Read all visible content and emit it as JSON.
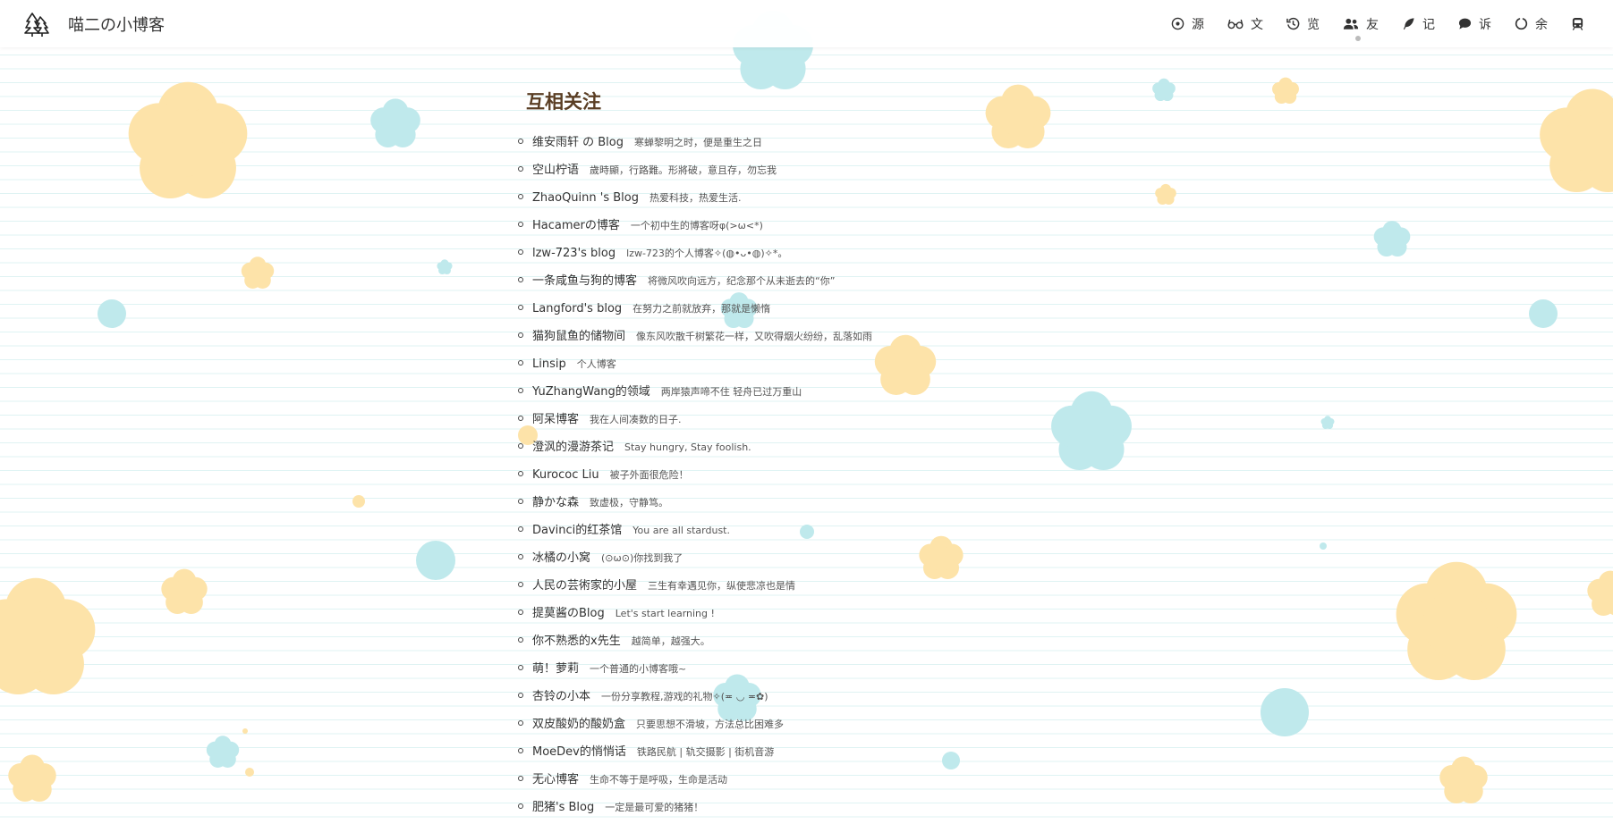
{
  "header": {
    "site_title": "喵二の小博客",
    "nav": [
      {
        "icon": "target-icon",
        "label": "源"
      },
      {
        "icon": "glasses-icon",
        "label": "文"
      },
      {
        "icon": "history-icon",
        "label": "览"
      },
      {
        "icon": "users-icon",
        "label": "友"
      },
      {
        "icon": "feather-icon",
        "label": "记"
      },
      {
        "icon": "comment-icon",
        "label": "诉"
      },
      {
        "icon": "circle-notch-icon",
        "label": "余"
      },
      {
        "icon": "train-icon",
        "label": ""
      }
    ]
  },
  "main": {
    "title": "互相关注",
    "friends": [
      {
        "name": "维安雨轩 の Blog",
        "desc": "寒蝉黎明之时，便是重生之日"
      },
      {
        "name": "空山柠语",
        "desc": "歲時顯，行路難。形將破，意且存，勿忘我"
      },
      {
        "name": "ZhaoQuinn 's Blog",
        "desc": "热爱科技，热爱生活."
      },
      {
        "name": "Hacamerの博客",
        "desc": "一个初中生的博客呀φ(>ω<*)"
      },
      {
        "name": "lzw-723's blog",
        "desc": "lzw-723的个人博客✧(◍•ᴗ•◍)✧*。"
      },
      {
        "name": "一条咸鱼与狗的博客",
        "desc": "将微风吹向远方，纪念那个从未逝去的“你”"
      },
      {
        "name": "Langford's blog",
        "desc": "在努力之前就放弃，那就是懒惰"
      },
      {
        "name": "猫狗鼠鱼的储物间",
        "desc": "像东风吹散千树繁花一样，又吹得烟火纷纷，乱落如雨"
      },
      {
        "name": "Linsip",
        "desc": "个人博客"
      },
      {
        "name": "YuZhangWang的领域",
        "desc": "两岸猿声啼不住 轻舟已过万重山"
      },
      {
        "name": "阿呆博客",
        "desc": "我在人间凑数的日子."
      },
      {
        "name": "澄沨的漫游茶记",
        "desc": "Stay hungry, Stay foolish."
      },
      {
        "name": "Kurococ Liu",
        "desc": "被子外面很危险！"
      },
      {
        "name": "静かな森",
        "desc": "致虚极，守静笃。"
      },
      {
        "name": "Davinci的红茶馆",
        "desc": "You are all stardust."
      },
      {
        "name": "冰橘の小窝",
        "desc": "(⊙ω⊙)你找到我了"
      },
      {
        "name": "人民の芸術家的小屋",
        "desc": "三生有幸遇见你，纵使悲凉也是情"
      },
      {
        "name": "提莫酱のBlog",
        "desc": "Let's start learning !"
      },
      {
        "name": "你不熟悉的x先生",
        "desc": "越简单，越强大。"
      },
      {
        "name": "萌！萝莉",
        "desc": "一个普通的小博客哦~"
      },
      {
        "name": "杏铃の小本",
        "desc": "一份分享教程,游戏的礼物✧(≖ ◡ ≖✿)"
      },
      {
        "name": "双皮酸奶的酸奶盒",
        "desc": "只要思想不滑坡，方法总比困难多"
      },
      {
        "name": "MoeDev的悄悄话",
        "desc": "铁路民航 | 轨交摄影 | 街机音游"
      },
      {
        "name": "无心博客",
        "desc": "生命不等于是呼吸，生命是活动"
      },
      {
        "name": "肥猪's Blog",
        "desc": "一定是最可爱的猪猪！"
      }
    ]
  },
  "colors": {
    "flower_yellow": "#fde3a9",
    "bubble_blue": "#bfe9ec",
    "title_brown": "#5a3e24",
    "ruled_line": "#dff3f3"
  }
}
